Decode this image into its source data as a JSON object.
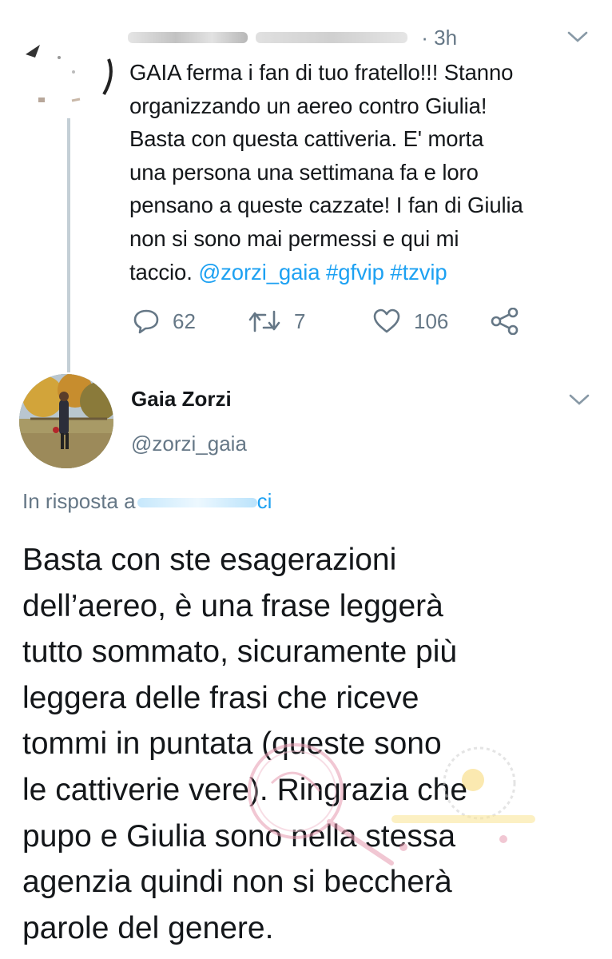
{
  "parent_tweet": {
    "timestamp": "3h",
    "text_lines": [
      "GAIA ferma i fan di tuo fratello!!! Stanno",
      "organizzando un aereo contro Giulia!",
      "Basta con questa cattiveria. E' morta",
      "una persona una settimana fa e loro",
      "pensano a queste cazzate! I fan di Giulia",
      "non si sono mai permessi e qui mi"
    ],
    "last_line_text": "taccio.",
    "mention": "@zorzi_gaia",
    "hashtags": [
      "#gfvip",
      "#tzvip"
    ],
    "actions": {
      "reply_count": "62",
      "retweet_count": "7",
      "like_count": "106"
    }
  },
  "reply_tweet": {
    "author_name": "Gaia Zorzi",
    "author_handle": "@zorzi_gaia",
    "in_reply_prefix": "In risposta a",
    "in_reply_suffix": "ci",
    "text_lines": [
      "Basta con ste esagerazioni",
      "dell’aereo, è una frase leggerà",
      "tutto sommato, sicuramente più",
      "leggera delle frasi che riceve",
      "tommi in puntata (queste sono",
      "le cattiverie vere). Ringrazia che",
      "pupo e Giulia sono nella stessa",
      "agenzia quindi non si beccherà",
      "parole del genere."
    ]
  },
  "icons": {
    "reply": "speech-bubble-icon",
    "retweet": "retweet-icon",
    "like": "heart-icon",
    "share": "share-icon",
    "menu": "chevron-down-icon"
  },
  "colors": {
    "text": "#14171a",
    "secondary": "#657786",
    "link": "#1da1f2",
    "thread_line": "#c4cfd6"
  }
}
